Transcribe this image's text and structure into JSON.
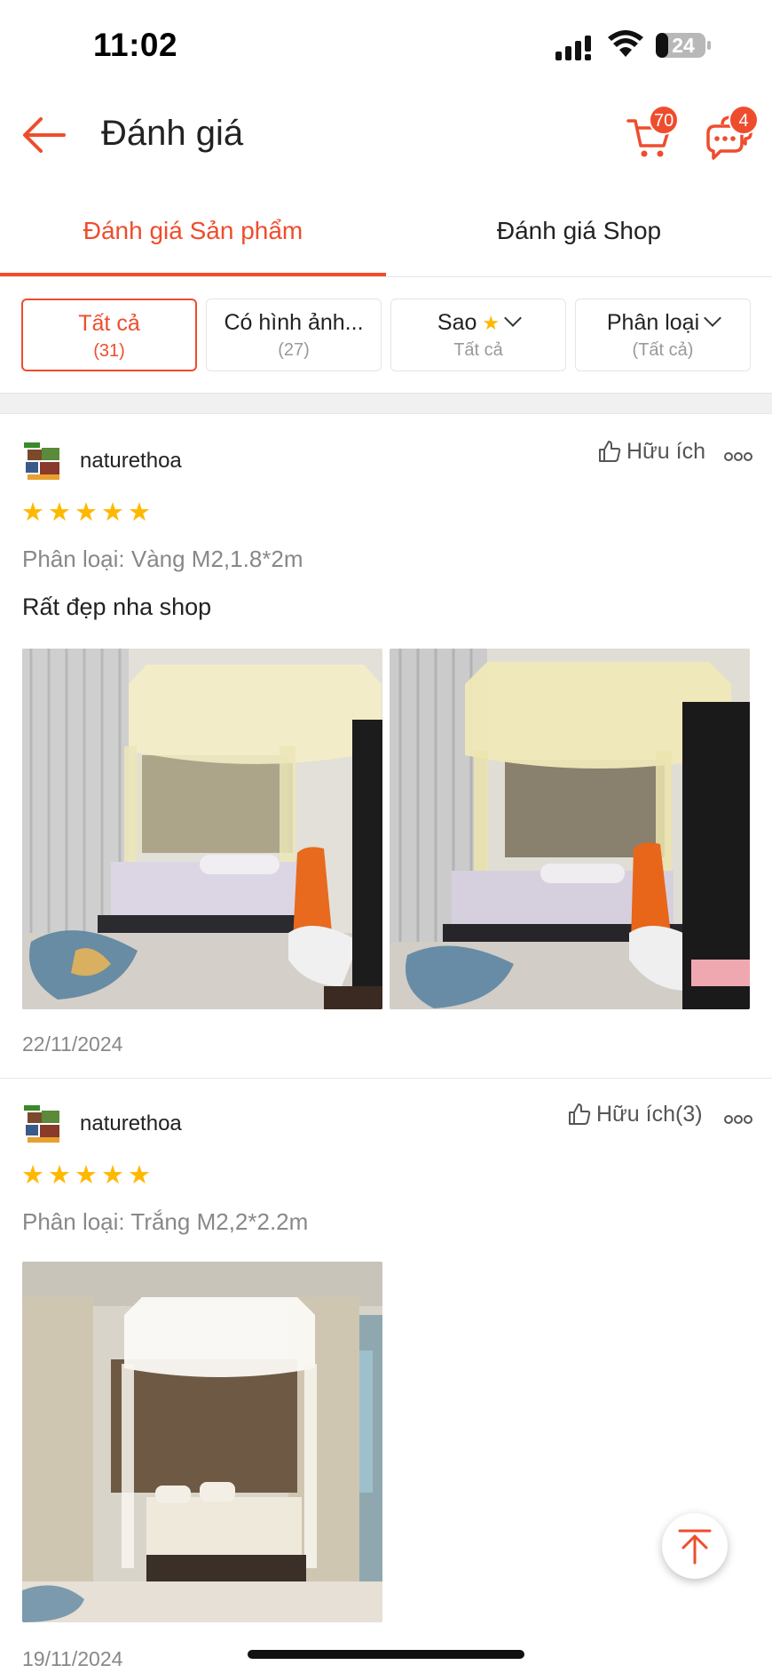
{
  "status_bar": {
    "time": "11:02",
    "battery": "24"
  },
  "header": {
    "title": "Đánh giá",
    "cart_badge": "70",
    "chat_badge": "4"
  },
  "tabs": [
    {
      "label": "Đánh giá Sản phẩm"
    },
    {
      "label": "Đánh giá Shop"
    }
  ],
  "filters": [
    {
      "label": "Tất cả",
      "sub": "(31)"
    },
    {
      "label": "Có hình ảnh...",
      "sub": "(27)"
    },
    {
      "label": "Sao",
      "sub": "Tất cả"
    },
    {
      "label": "Phân loại",
      "sub": "(Tất cả)"
    }
  ],
  "reviews": [
    {
      "user": "naturethoa",
      "helpful": "Hữu ích",
      "stars": 5,
      "variant": "Phân loại: Vàng M2,1.8*2m",
      "comment": "Rất đẹp nha shop",
      "photos": [
        "bedroom-yellow-canopy-photo",
        "bedroom-yellow-canopy-photo"
      ],
      "date": "22/11/2024"
    },
    {
      "user": "naturethoa",
      "helpful": "Hữu ích(3)",
      "stars": 5,
      "variant": "Phân loại: Trắng M2,2*2.2m",
      "comment": "",
      "photos": [
        "bedroom-white-canopy-photo"
      ],
      "date": "19/11/2024"
    }
  ],
  "colors": {
    "accent": "#ee4d2d",
    "star": "#ffb800"
  },
  "icons": [
    "back-arrow-icon",
    "cart-icon",
    "chat-icon",
    "thumbs-up-icon",
    "more-icon",
    "scroll-top-icon"
  ]
}
